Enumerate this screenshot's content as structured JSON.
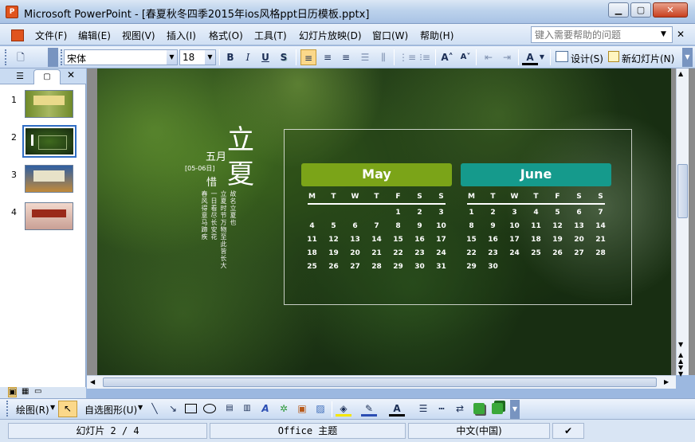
{
  "window": {
    "title": "Microsoft PowerPoint - [春夏秋冬四季2015年ios风格ppt日历模板.pptx]",
    "min": "▁",
    "max": "▢",
    "close": "✕"
  },
  "menu": {
    "items": [
      "文件(F)",
      "编辑(E)",
      "视图(V)",
      "插入(I)",
      "格式(O)",
      "工具(T)",
      "幻灯片放映(D)",
      "窗口(W)",
      "帮助(H)"
    ],
    "help_placeholder": "键入需要帮助的问题"
  },
  "toolbar": {
    "font": "宋体",
    "size": "18",
    "bold": "B",
    "italic": "I",
    "underline": "U",
    "shadow": "S",
    "design": "设计(S)",
    "new_slide": "新幻灯片(N)"
  },
  "slides": {
    "numbers": [
      "1",
      "2",
      "3",
      "4"
    ],
    "selected": 2
  },
  "slide": {
    "month_label": "五月",
    "title_char1": "立",
    "title_char2": "夏",
    "date_tag": "[05-06日]",
    "xi": "惜",
    "vertical_lines": [
      "春风得意马蹄疾",
      "一日看尽长安花",
      "立夏时节万物至此皆长大",
      "故名立夏也"
    ],
    "cal_may": {
      "name": "May",
      "color": "#7ba418",
      "weekdays": [
        "M",
        "T",
        "W",
        "T",
        "F",
        "S",
        "S"
      ],
      "rows": [
        [
          "",
          "",
          "",
          "",
          "1",
          "2",
          "3"
        ],
        [
          "4",
          "5",
          "6",
          "7",
          "8",
          "9",
          "10"
        ],
        [
          "11",
          "12",
          "13",
          "14",
          "15",
          "16",
          "17"
        ],
        [
          "18",
          "19",
          "20",
          "21",
          "22",
          "23",
          "24"
        ],
        [
          "25",
          "26",
          "27",
          "28",
          "29",
          "30",
          "31"
        ]
      ]
    },
    "cal_june": {
      "name": "June",
      "color": "#159a8c",
      "weekdays": [
        "M",
        "T",
        "W",
        "T",
        "F",
        "S",
        "S"
      ],
      "rows": [
        [
          "1",
          "2",
          "3",
          "4",
          "5",
          "6",
          "7"
        ],
        [
          "8",
          "9",
          "10",
          "11",
          "12",
          "13",
          "14"
        ],
        [
          "15",
          "16",
          "17",
          "18",
          "19",
          "20",
          "21"
        ],
        [
          "22",
          "23",
          "24",
          "25",
          "26",
          "27",
          "28"
        ],
        [
          "29",
          "30",
          "",
          "",
          "",
          "",
          ""
        ]
      ]
    }
  },
  "drawbar": {
    "draw": "绘图(R)",
    "autoshape": "自选图形(U)"
  },
  "status": {
    "slide": "幻灯片 2 / 4",
    "theme": "Office 主题",
    "lang": "中文(中国)"
  }
}
